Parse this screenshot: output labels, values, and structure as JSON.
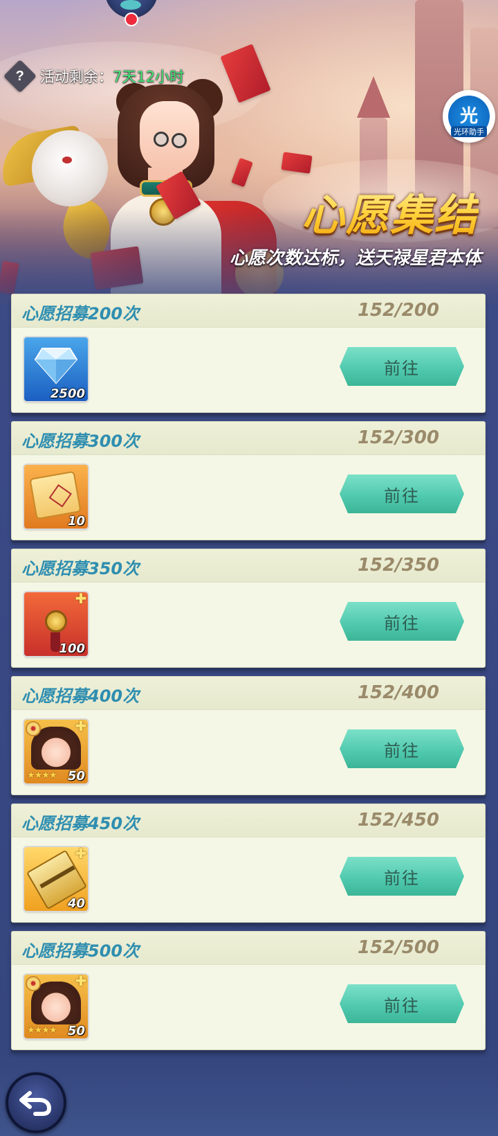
{
  "header": {
    "timer_label": "活动剩余：",
    "timer_value": "7天12小时",
    "help_icon": "question-icon",
    "assistant_glyph": "光",
    "assistant_caption": "光环助手"
  },
  "banner": {
    "title": "心愿集结",
    "subtitle": "心愿次数达标，送天禄星君本体"
  },
  "tasks": [
    {
      "title": "心愿招募200次",
      "progress": "152/200",
      "reward_icon": "diamond-icon",
      "reward_count": "2500",
      "button_label": "前往"
    },
    {
      "title": "心愿招募300次",
      "progress": "152/300",
      "reward_icon": "scroll-icon",
      "reward_count": "10",
      "button_label": "前往"
    },
    {
      "title": "心愿招募350次",
      "progress": "152/350",
      "reward_icon": "lucky-knot-icon",
      "reward_count": "100",
      "button_label": "前往"
    },
    {
      "title": "心愿招募400次",
      "progress": "152/400",
      "reward_icon": "hero-shard-icon",
      "reward_count": "50",
      "button_label": "前往"
    },
    {
      "title": "心愿招募450次",
      "progress": "152/450",
      "reward_icon": "ticket-icon",
      "reward_count": "40",
      "button_label": "前往"
    },
    {
      "title": "心愿招募500次",
      "progress": "152/500",
      "reward_icon": "hero-shard-icon",
      "reward_count": "50",
      "button_label": "前往"
    }
  ],
  "colors": {
    "accent_green": "#45e873",
    "title_blue": "#2f8eb0",
    "button_teal": "#4ec8ad",
    "card_bg": "#f5f7e6",
    "page_bg": "#3b4a86"
  },
  "navigation": {
    "back_icon": "back-arrow-icon"
  }
}
